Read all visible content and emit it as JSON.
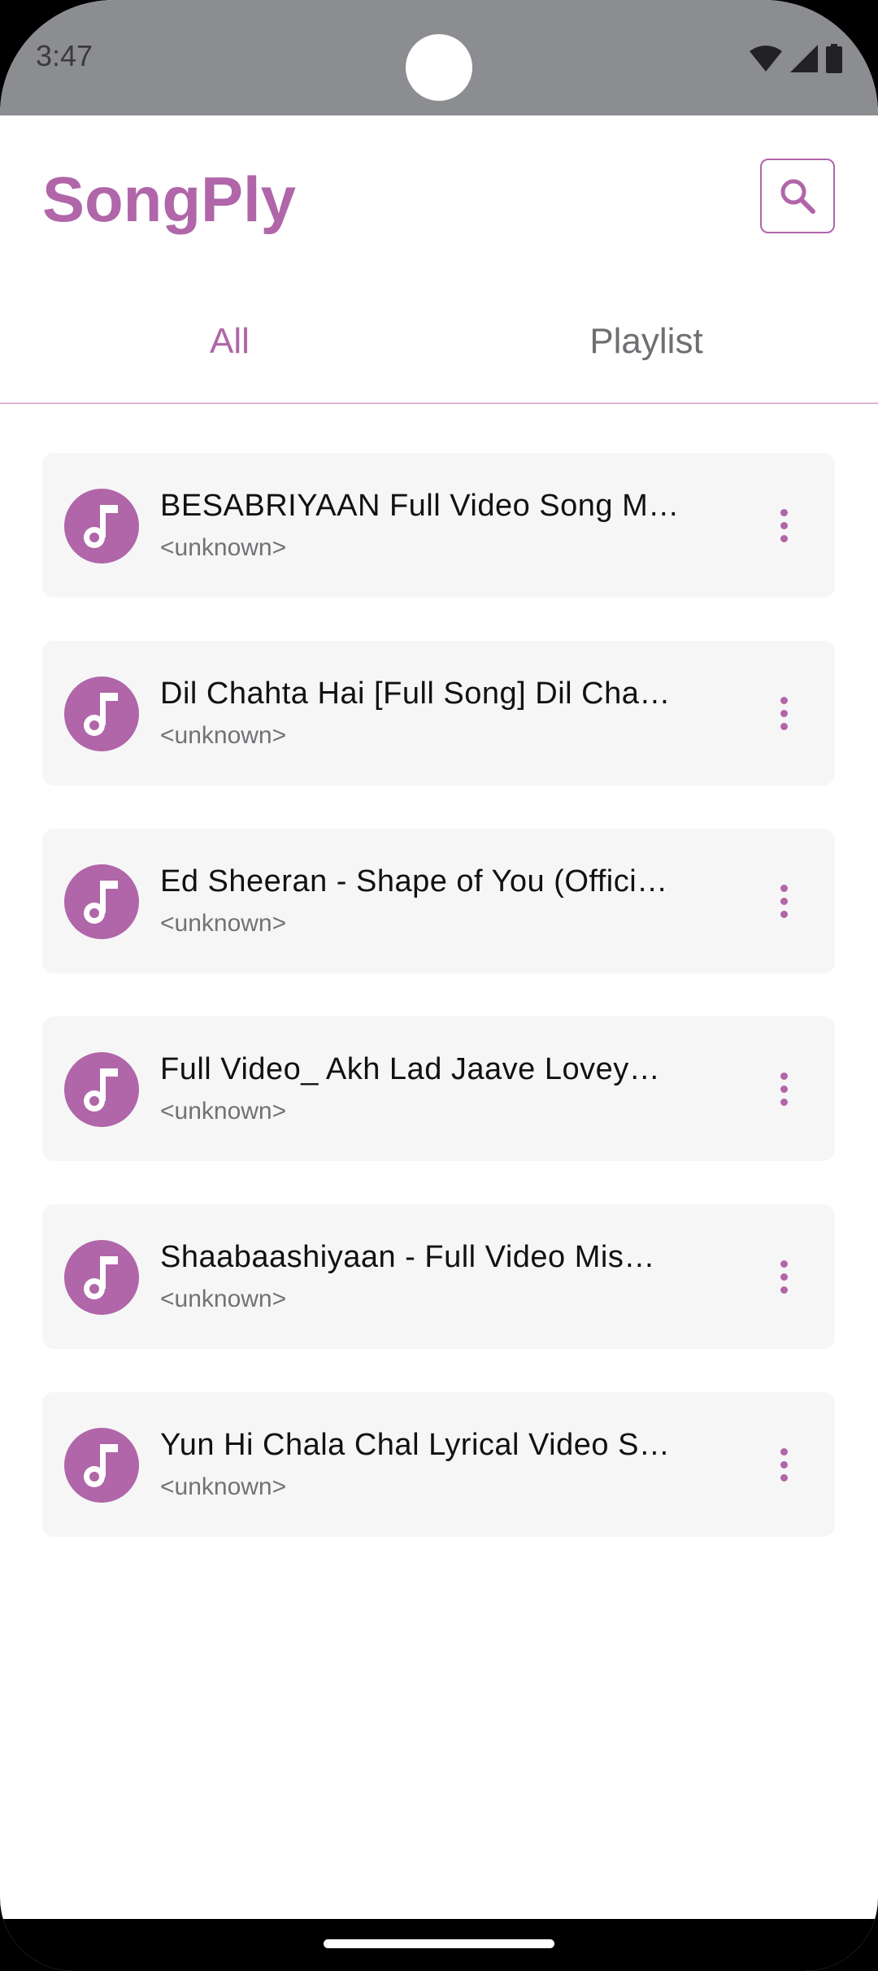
{
  "status_bar": {
    "time": "3:47",
    "icons": [
      "wifi-icon",
      "signal-icon",
      "battery-icon"
    ]
  },
  "app": {
    "title": "SongPly",
    "search_icon": "search-icon",
    "accent_color": "#b066a8"
  },
  "tabs": [
    {
      "label": "All",
      "selected": true
    },
    {
      "label": "Playlist",
      "selected": false
    }
  ],
  "songs": [
    {
      "title": "BESABRIYAAN Full Video Song  M…",
      "artist": "<unknown>",
      "icon": "music-note-icon",
      "menu_icon": "more-vert-icon"
    },
    {
      "title": "Dil Chahta Hai [Full Song] Dil Cha…",
      "artist": "<unknown>",
      "icon": "music-note-icon",
      "menu_icon": "more-vert-icon"
    },
    {
      "title": "Ed Sheeran - Shape of You (Offici…",
      "artist": "<unknown>",
      "icon": "music-note-icon",
      "menu_icon": "more-vert-icon"
    },
    {
      "title": "Full Video_ Akh Lad Jaave  Lovey…",
      "artist": "<unknown>",
      "icon": "music-note-icon",
      "menu_icon": "more-vert-icon"
    },
    {
      "title": "Shaabaashiyaan - Full Video  Mis…",
      "artist": "<unknown>",
      "icon": "music-note-icon",
      "menu_icon": "more-vert-icon"
    },
    {
      "title": "Yun Hi Chala Chal Lyrical Video  S…",
      "artist": "<unknown>",
      "icon": "music-note-icon",
      "menu_icon": "more-vert-icon"
    }
  ]
}
